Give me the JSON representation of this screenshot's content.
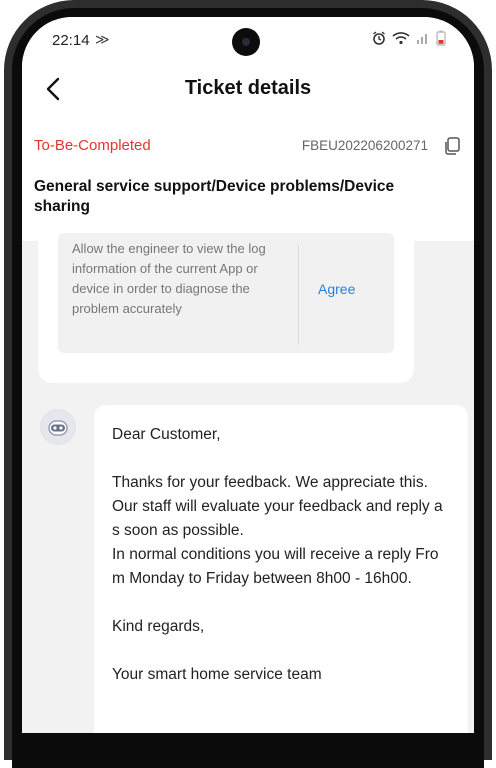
{
  "status_bar": {
    "time": "22:14",
    "extra": "≫",
    "icons": [
      "alarm-icon",
      "wifi-icon",
      "signal-icon",
      "battery-icon"
    ]
  },
  "nav": {
    "back_icon": "chevron-left-icon",
    "title": "Ticket details"
  },
  "ticket": {
    "status": "To-Be-Completed",
    "status_color": "#e5352b",
    "number": "FBEU202206200271",
    "copy_icon": "copy-icon",
    "category": "General service support/Device problems/Device sharing"
  },
  "consent": {
    "text": "Allow the engineer to view the log information of the current App or device in order to diagnose the problem accurately",
    "agree_label": "Agree",
    "agree_color": "#2a7de1"
  },
  "message": {
    "avatar_icon": "support-bot-icon",
    "body": "Dear Customer,\n\nThanks for your feedback. We appreciate this.\nOur staff will evaluate your feedback and reply as soon as possible.\nIn normal conditions you will receive a reply From Monday to Friday between 8h00 - 16h00.\n\nKind regards,\n\nYour smart home service team"
  }
}
